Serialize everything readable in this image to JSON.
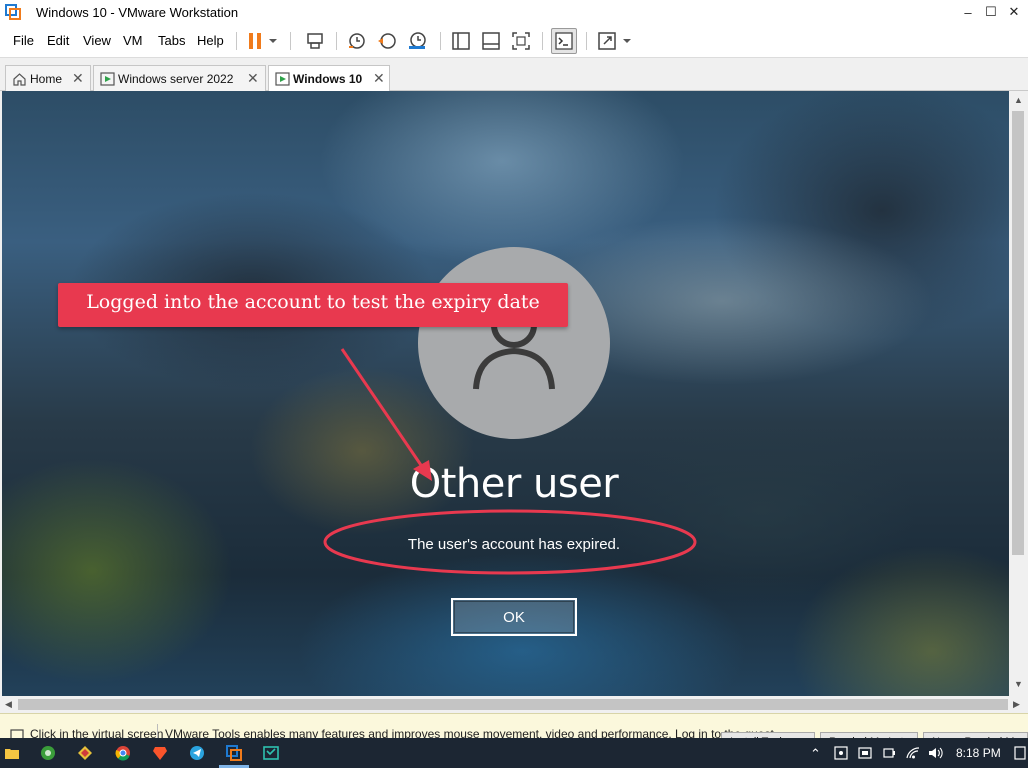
{
  "window": {
    "title": "Windows 10 - VMware Workstation",
    "minimize": "–",
    "maximize": "☐",
    "close": "✕"
  },
  "menu": [
    "File",
    "Edit",
    "View",
    "VM",
    "Tabs",
    "Help"
  ],
  "tabs": [
    {
      "label": "Home",
      "close": "✕",
      "active": false
    },
    {
      "label": "Windows server 2022",
      "close": "✕",
      "active": false
    },
    {
      "label": "Windows 10",
      "close": "✕",
      "active": true
    }
  ],
  "vm": {
    "user_name": "Other user",
    "message": "The user's account has expired.",
    "ok_label": "OK"
  },
  "annotation": {
    "callout_text": "Logged into the account to test the expiry date",
    "color": "#e8394f"
  },
  "statusbar": {
    "hint": "Click in the virtual screen",
    "message": "VMware Tools enables many features and improves mouse movement, video and performance. Log in to the guest",
    "buttons": [
      "Install Tools",
      "Remind Me Later",
      "Never Remind Me"
    ]
  },
  "taskbar": {
    "clock": "8:18 PM"
  },
  "colors": {
    "pause_icon": "#f07b1c",
    "accent": "#1f7ad1"
  }
}
